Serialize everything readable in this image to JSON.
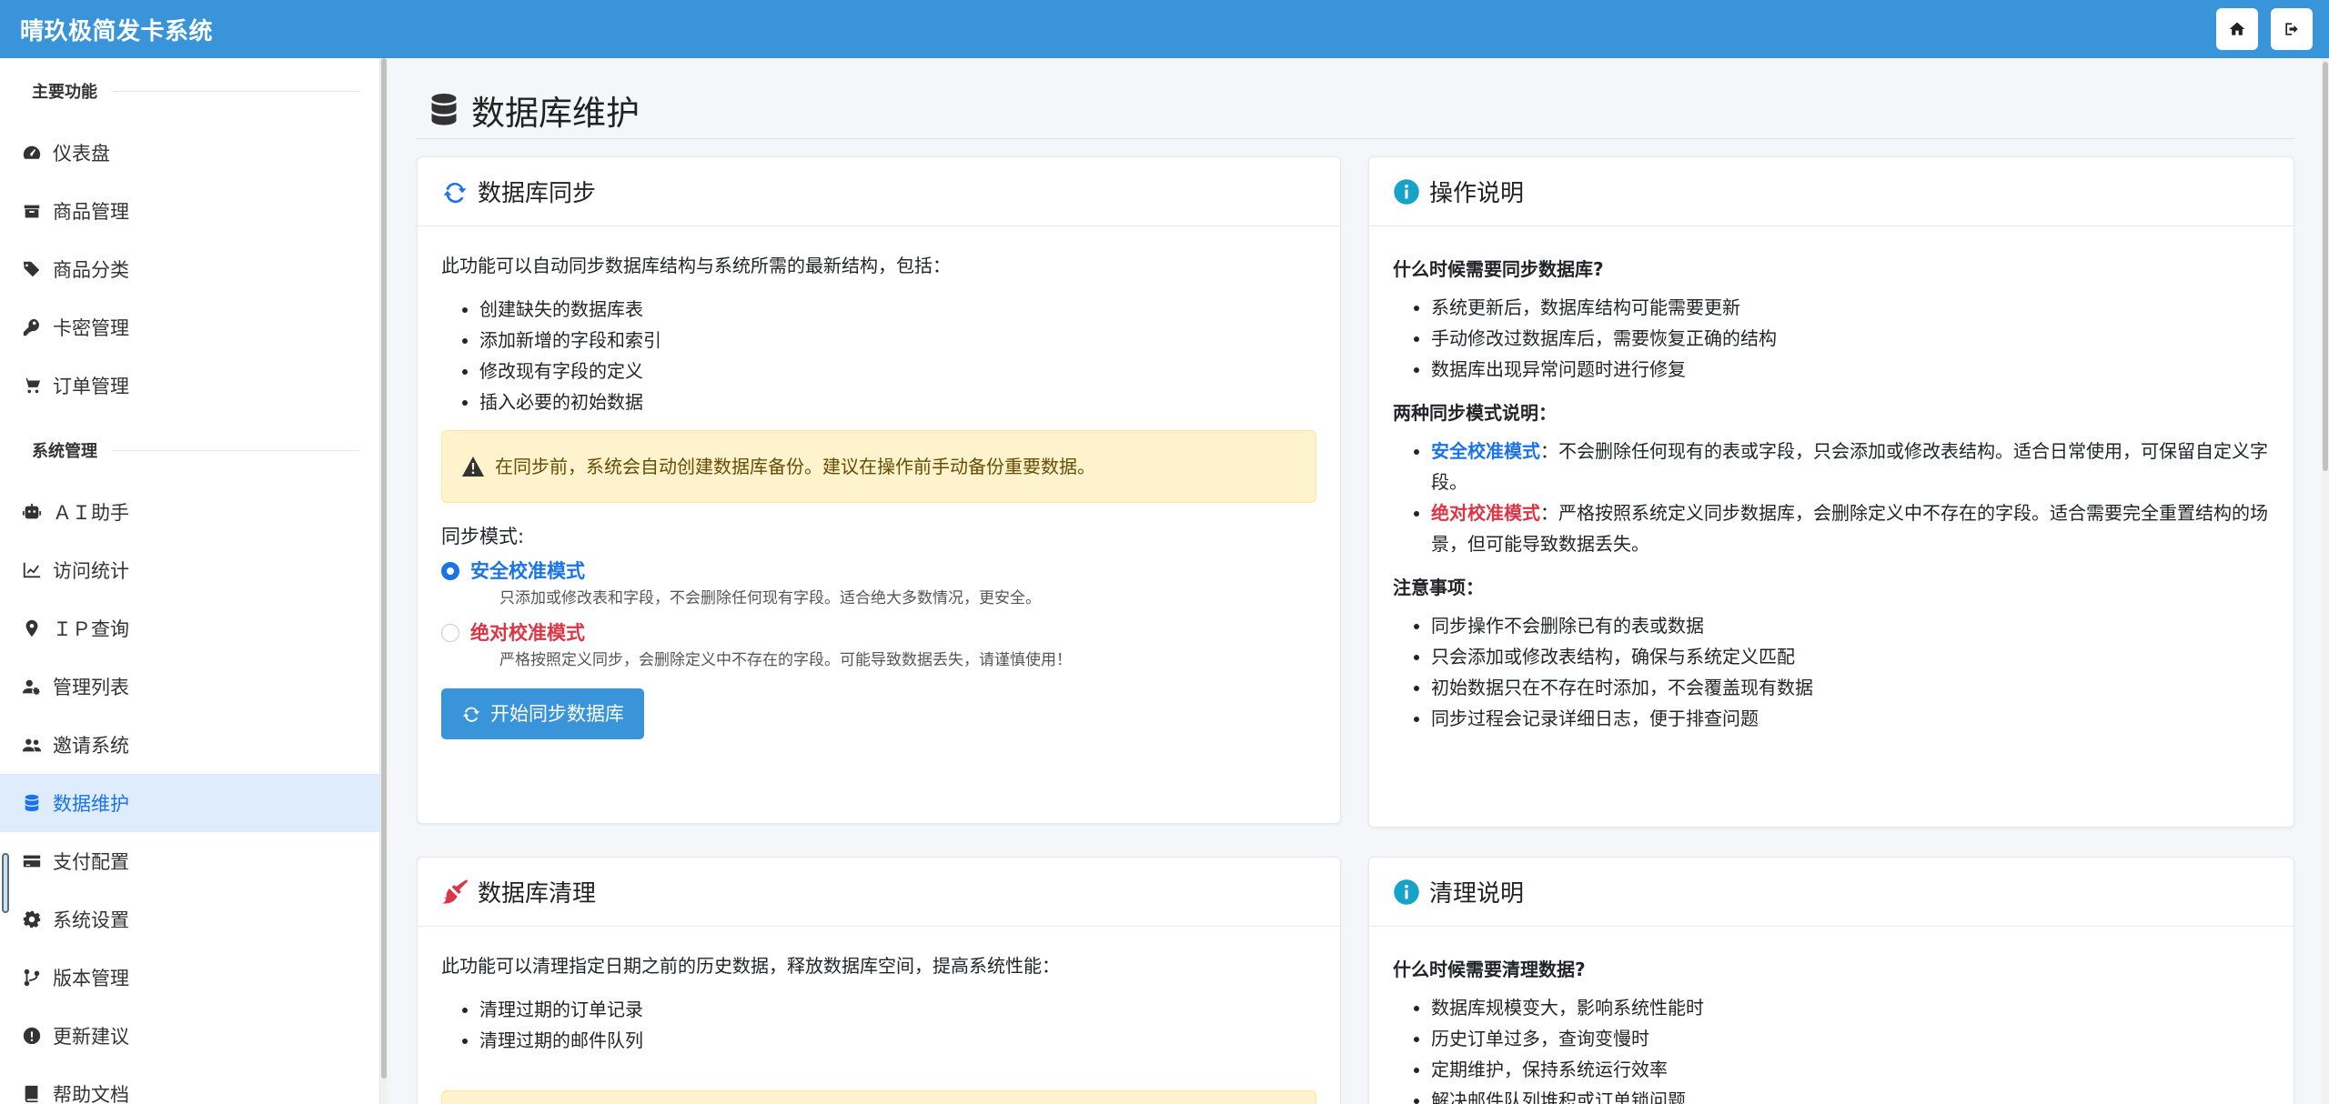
{
  "app": {
    "title": "晴玖极简发卡系统"
  },
  "colors": {
    "primary": "#3a94d9",
    "active_bg": "#deecfb",
    "active_text": "#1a73e8",
    "danger": "#dc3545",
    "warning_bg": "#fff3cd"
  },
  "navbar": {
    "home_icon": "home-icon",
    "logout_icon": "sign-out-icon"
  },
  "sidebar": {
    "section_main": "主要功能",
    "section_system": "系统管理",
    "main_items": [
      {
        "label": "仪表盘",
        "icon": "dashboard-icon"
      },
      {
        "label": "商品管理",
        "icon": "box-icon"
      },
      {
        "label": "商品分类",
        "icon": "tags-icon"
      },
      {
        "label": "卡密管理",
        "icon": "key-icon"
      },
      {
        "label": "订单管理",
        "icon": "cart-icon"
      }
    ],
    "system_items": [
      {
        "label": "ＡＩ助手",
        "icon": "robot-icon"
      },
      {
        "label": "访问统计",
        "icon": "chart-line-icon"
      },
      {
        "label": "ＩＰ查询",
        "icon": "map-marker-icon"
      },
      {
        "label": "管理列表",
        "icon": "users-cog-icon"
      },
      {
        "label": "邀请系统",
        "icon": "users-icon"
      },
      {
        "label": "数据维护",
        "icon": "database-icon",
        "active": true
      },
      {
        "label": "支付配置",
        "icon": "credit-card-icon"
      },
      {
        "label": "系统设置",
        "icon": "gear-icon"
      },
      {
        "label": "版本管理",
        "icon": "code-branch-icon"
      },
      {
        "label": "更新建议",
        "icon": "exclamation-circle-icon"
      },
      {
        "label": "帮助文档",
        "icon": "book-icon"
      }
    ]
  },
  "page": {
    "title": "数据库维护"
  },
  "sync_card": {
    "title": "数据库同步",
    "intro": "此功能可以自动同步数据库结构与系统所需的最新结构，包括：",
    "items": [
      "创建缺失的数据库表",
      "添加新增的字段和索引",
      "修改现有字段的定义",
      "插入必要的初始数据"
    ],
    "alert": "在同步前，系统会自动创建数据库备份。建议在操作前手动备份重要数据。",
    "mode_label": "同步模式:",
    "safe_title": "安全校准模式",
    "safe_desc": "只添加或修改表和字段，不会删除任何现有字段。适合绝大多数情况，更安全。",
    "absolute_title": "绝对校准模式",
    "absolute_desc": "严格按照定义同步，会删除定义中不存在的字段。可能导致数据丢失，请谨慎使用！",
    "button": "开始同步数据库"
  },
  "ops_card": {
    "title": "操作说明",
    "h1": "什么时候需要同步数据库?",
    "list1": [
      "系统更新后，数据库结构可能需要更新",
      "手动修改过数据库后，需要恢复正确的结构",
      "数据库出现异常问题时进行修复"
    ],
    "h2": "两种同步模式说明：",
    "safe_name": "安全校准模式",
    "safe_text": "：不会删除任何现有的表或字段，只会添加或修改表结构。适合日常使用，可保留自定义字段。",
    "abs_name": "绝对校准模式",
    "abs_text": "：严格按照系统定义同步数据库，会删除定义中不存在的字段。适合需要完全重置结构的场景，但可能导致数据丢失。",
    "h3": "注意事项：",
    "list3": [
      "同步操作不会删除已有的表或数据",
      "只会添加或修改表结构，确保与系统定义匹配",
      "初始数据只在不存在时添加，不会覆盖现有数据",
      "同步过程会记录详细日志，便于排查问题"
    ]
  },
  "clean_card": {
    "title": "数据库清理",
    "intro": "此功能可以清理指定日期之前的历史数据，释放数据库空间，提高系统性能：",
    "items": [
      "清理过期的订单记录",
      "清理过期的邮件队列"
    ]
  },
  "clean_help_card": {
    "title": "清理说明",
    "h1": "什么时候需要清理数据?",
    "list1": [
      "数据库规模变大，影响系统性能时",
      "历史订单过多，查询变慢时",
      "定期维护，保持系统运行效率",
      "解决邮件队列堆积或订单锁问题"
    ]
  }
}
